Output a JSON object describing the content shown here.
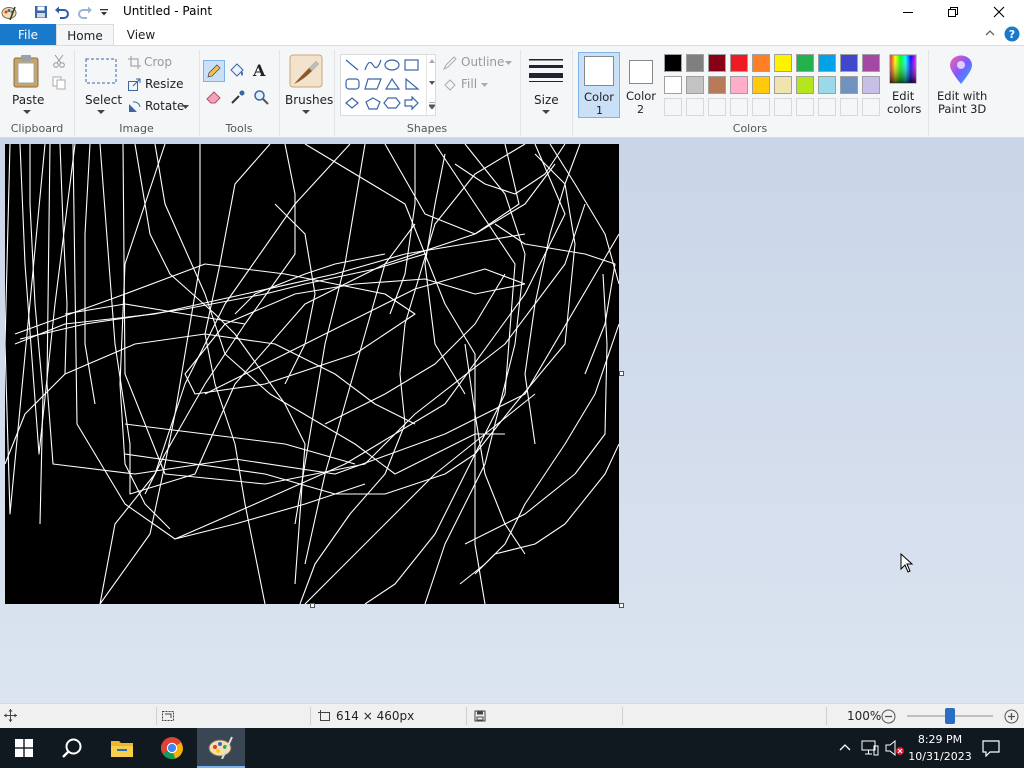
{
  "window": {
    "title": "Untitled - Paint",
    "minimize_icon": "minimize-icon",
    "restore_icon": "restore-icon",
    "close_icon": "close-icon"
  },
  "quick_access": [
    "paint-app-icon",
    "save-icon",
    "undo-icon",
    "redo-icon",
    "customize-dropdown-icon"
  ],
  "tabs": {
    "file": "File",
    "home": "Home",
    "view": "View"
  },
  "ribbon": {
    "clipboard": {
      "label": "Clipboard",
      "paste": "Paste"
    },
    "image": {
      "label": "Image",
      "select": "Select",
      "crop": "Crop",
      "resize": "Resize",
      "rotate": "Rotate"
    },
    "tools": {
      "label": "Tools"
    },
    "brushes": {
      "label": "Brushes"
    },
    "shapes": {
      "label": "Shapes",
      "outline": "Outline",
      "fill": "Fill"
    },
    "size": {
      "label": "Size"
    },
    "colors": {
      "label": "Colors",
      "color1": {
        "line1": "Color",
        "line2": "1",
        "value": "#ffffff"
      },
      "color2": {
        "line1": "Color",
        "line2": "2",
        "value": "#ffffff"
      },
      "edit_colors": {
        "line1": "Edit",
        "line2": "colors"
      },
      "palette_row1": [
        "#000000",
        "#7f7f7f",
        "#880015",
        "#ed1c24",
        "#ff7f27",
        "#fff200",
        "#22b14c",
        "#00a2e8",
        "#3f48cc",
        "#a349a4"
      ],
      "palette_row2": [
        "#ffffff",
        "#c3c3c3",
        "#b97a57",
        "#ffaec9",
        "#ffc90e",
        "#efe4b0",
        "#b5e61d",
        "#99d9ea",
        "#7092be",
        "#c8bfe7"
      ]
    },
    "paint3d": {
      "line1": "Edit with",
      "line2": "Paint 3D"
    }
  },
  "canvas": {
    "background": "#000000",
    "stroke": "#ffffff"
  },
  "status": {
    "dimensions": "614 × 460px",
    "zoom": "100%",
    "zoom_fraction": 0.5
  },
  "taskbar": {
    "items": [
      "start-icon",
      "search-icon",
      "file-explorer-icon",
      "chrome-icon",
      "paint-icon"
    ],
    "time": "8:29 PM",
    "date": "10/31/2023"
  },
  "accent": "#1979ca"
}
